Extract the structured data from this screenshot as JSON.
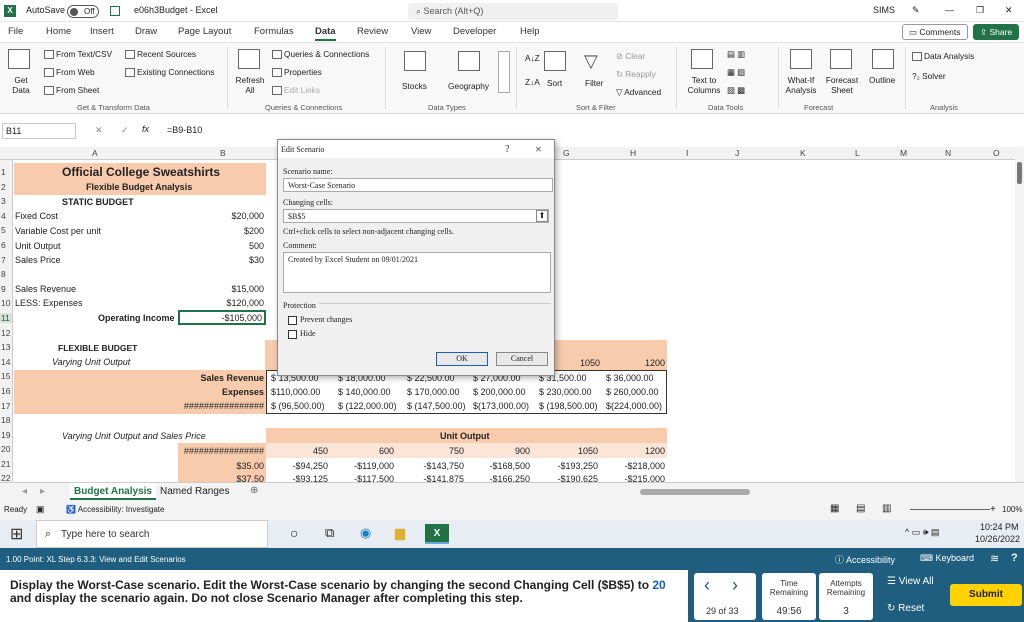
{
  "titlebar": {
    "autosave": "AutoSave",
    "toggle": "Off",
    "filename": "e06h3Budget - Excel",
    "search": "Search (Alt+Q)",
    "user": "SIMS"
  },
  "tabs": [
    "File",
    "Home",
    "Insert",
    "Draw",
    "Page Layout",
    "Formulas",
    "Data",
    "Review",
    "View",
    "Developer",
    "Help"
  ],
  "comments": "Comments",
  "share": "Share",
  "ribbon": {
    "get_data": "Get Data",
    "from_text": "From Text/CSV",
    "from_web": "From Web",
    "from_sheet": "From Sheet",
    "recent_sources": "Recent Sources",
    "existing_connections": "Existing Connections",
    "group1": "Get & Transform Data",
    "refresh_all": "Refresh All",
    "queries_connections": "Queries & Connections",
    "properties": "Properties",
    "edit_links": "Edit Links",
    "group2": "Queries & Connections",
    "stocks": "Stocks",
    "geography": "Geography",
    "group3": "Data Types",
    "sort": "Sort",
    "filter": "Filter",
    "clear": "Clear",
    "reapply": "Reapply",
    "advanced": "Advanced",
    "group4": "Sort & Filter",
    "text_to_columns": "Text to Columns",
    "group5": "Data Tools",
    "what_if": "What-If Analysis",
    "forecast_sheet": "Forecast Sheet",
    "group6": "Forecast",
    "outline": "Outline",
    "data_analysis": "Data Analysis",
    "solver": "Solver",
    "group7": "Analysis"
  },
  "formula_bar": {
    "name_box": "B11",
    "fx": "fx",
    "formula": "=B9-B10"
  },
  "columns": [
    "A",
    "B",
    "C",
    "D",
    "E",
    "F",
    "G",
    "H",
    "I",
    "J",
    "K",
    "L",
    "M",
    "N",
    "O"
  ],
  "rows": [
    "1",
    "2",
    "3",
    "4",
    "5",
    "6",
    "7",
    "8",
    "9",
    "10",
    "11",
    "12",
    "13",
    "14",
    "15",
    "16",
    "17",
    "18",
    "19",
    "20",
    "21",
    "22"
  ],
  "sheet": {
    "title": "Official College Sweatshirts",
    "subtitle": "Flexible Budget Analysis",
    "static_budget": "STATIC BUDGET",
    "fixed_cost": "Fixed Cost",
    "fixed_cost_val": "$20,000",
    "var_cost": "Variable Cost per unit",
    "var_cost_val": "$200",
    "unit_output": "Unit Output",
    "unit_output_val": "500",
    "sales_price": "Sales Price",
    "sales_price_val": "$30",
    "sales_revenue": "Sales Revenue",
    "sales_revenue_val": "$15,000",
    "less_expenses": "LESS: Expenses",
    "less_expenses_val": "$120,000",
    "operating_income": "Operating Income",
    "operating_income_val": "-$105,000",
    "flexible_budget": "FLEXIBLE BUDGET",
    "varying_unit_output": "Varying Unit Output",
    "row14_vals": [
      "1050",
      "1200"
    ],
    "sales_revenue_label": "Sales Revenue",
    "expenses_label": "Expenses",
    "hashes": "################",
    "row15_vals": [
      "$ 13,500.00",
      "$ 18,000.00",
      "$ 22,500.00",
      "$ 27,000.00",
      "$ 31,500.00",
      "$ 36,000.00"
    ],
    "row16_vals": [
      "$110,000.00",
      "$ 140,000.00",
      "$ 170,000.00",
      "$ 200,000.00",
      "$ 230,000.00",
      "$ 260,000.00"
    ],
    "row17_vals": [
      "$ (96,500.00)",
      "$ (122,000.00)",
      "$ (147,500.00)",
      "$(173,000.00)",
      "$ (198,500.00)",
      "$(224,000.00)"
    ],
    "varying_both": "Varying Unit Output and Sales Price",
    "unit_output_header": "Unit Output",
    "row20_vals": [
      "450",
      "600",
      "750",
      "900",
      "1050",
      "1200"
    ],
    "row21_price": "$35.00",
    "row21_vals": [
      "-$94,250",
      "-$119,000",
      "-$143,750",
      "-$168,500",
      "-$193,250",
      "-$218,000"
    ],
    "row22_price": "$37.50",
    "row22_vals": [
      "-$93,125",
      "-$117,500",
      "-$141,875",
      "-$166,250",
      "-$190,625",
      "-$215,000"
    ]
  },
  "dialog": {
    "title": "Edit Scenario",
    "help": "?",
    "close": "×",
    "scenario_name_label": "Scenario name:",
    "scenario_name": "Worst-Case Scenario",
    "changing_cells_label": "Changing cells:",
    "changing_cells": "$B$5",
    "hint": "Ctrl+click cells to select non-adjacent changing cells.",
    "comment_label": "Comment:",
    "comment": "Created by Excel Student on 09/01/2021",
    "protection": "Protection",
    "prevent_changes": "Prevent changes",
    "hide": "Hide",
    "ok": "OK",
    "cancel": "Cancel"
  },
  "sheet_tabs": [
    "Budget Analysis",
    "Named Ranges"
  ],
  "status": {
    "ready": "Ready",
    "accessibility": "Accessibility: Investigate",
    "zoom": "100%"
  },
  "taskbar": {
    "search": "Type here to search",
    "time": "10:24 PM",
    "date": "10/26/2022"
  },
  "task": {
    "header": "1.00 Point: XL Step 6.3.3: View and Edit Scenarios",
    "accessibility": "Accessibility",
    "keyboard": "Keyboard",
    "instruction_pre": "Display the Worst-Case scenario. Edit the Worst-Case scenario by changing the second Changing Cell ($B$5) to ",
    "instruction_num": "20",
    "instruction_post": " and display the scenario again. Do not close Scenario Manager after completing this step.",
    "page": "29 of 33",
    "time_label": "Time Remaining",
    "time": "49:56",
    "attempts_label": "Attempts Remaining",
    "attempts": "3",
    "view_all": "View All",
    "reset": "Reset",
    "submit": "Submit"
  },
  "colors": {
    "excel_green": "#217346",
    "band": "#f8cbad",
    "title_fill": "#f8cbad",
    "task_blue": "#1f5e7e",
    "submit": "#ffd200"
  }
}
